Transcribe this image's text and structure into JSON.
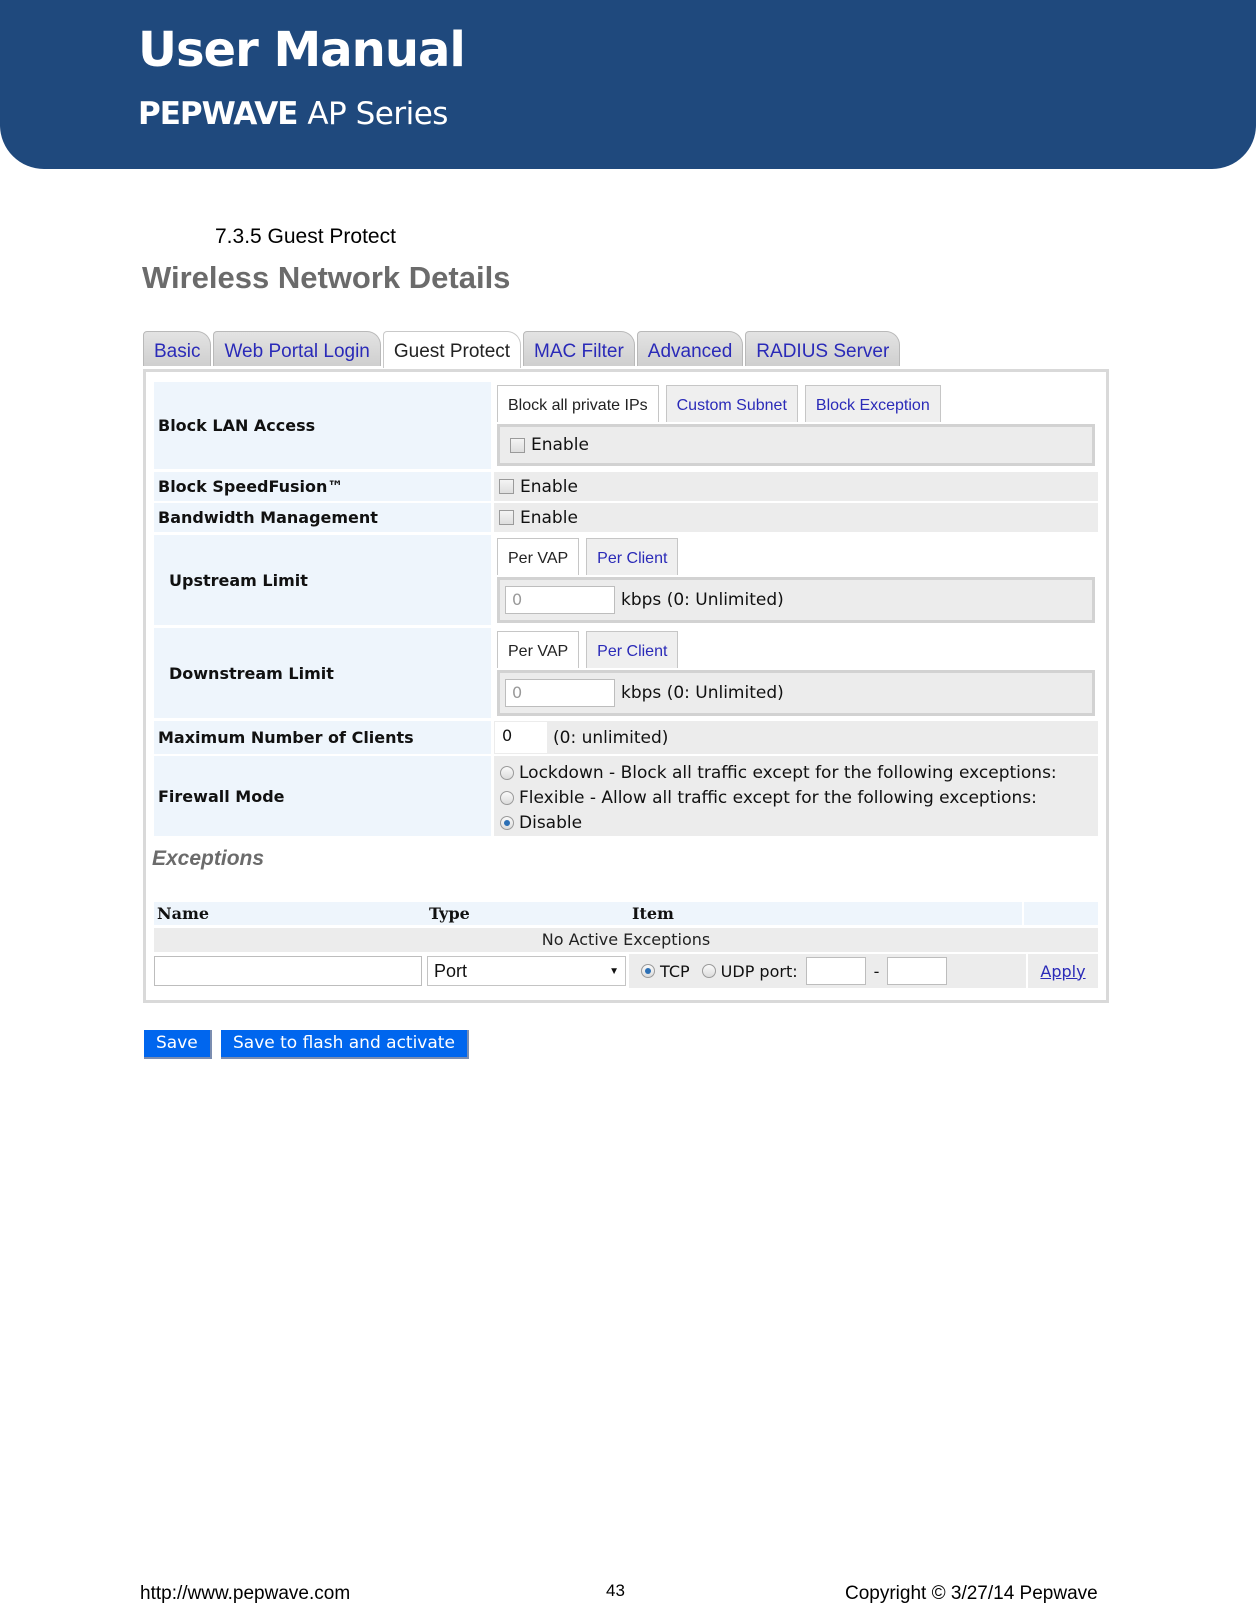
{
  "header": {
    "title": "User Manual",
    "brand": "PEPWAVE",
    "series": "AP Series",
    "color": "#1f497d"
  },
  "section_heading": "7.3.5 Guest Protect",
  "page_title": "Wireless Network Details",
  "tabs": [
    {
      "label": "Basic",
      "active": false
    },
    {
      "label": "Web Portal Login",
      "active": false
    },
    {
      "label": "Guest Protect",
      "active": true
    },
    {
      "label": "MAC Filter",
      "active": false
    },
    {
      "label": "Advanced",
      "active": false
    },
    {
      "label": "RADIUS Server",
      "active": false
    }
  ],
  "form": {
    "block_lan": {
      "label": "Block LAN Access",
      "subtabs": [
        "Block all private IPs",
        "Custom Subnet",
        "Block Exception"
      ],
      "active_subtab": "Block all private IPs",
      "enable_label": "Enable",
      "enabled": false
    },
    "block_speedfusion": {
      "label": "Block SpeedFusion™",
      "enable_label": "Enable",
      "enabled": false
    },
    "bandwidth_management": {
      "label": "Bandwidth Management",
      "enable_label": "Enable",
      "enabled": false
    },
    "upstream": {
      "label": "Upstream Limit",
      "subtabs": [
        "Per VAP",
        "Per Client"
      ],
      "active_subtab": "Per VAP",
      "value": "0",
      "unit": "kbps (0: Unlimited)"
    },
    "downstream": {
      "label": "Downstream Limit",
      "subtabs": [
        "Per VAP",
        "Per Client"
      ],
      "active_subtab": "Per VAP",
      "value": "0",
      "unit": "kbps (0: Unlimited)"
    },
    "max_clients": {
      "label": "Maximum Number of Clients",
      "value": "0",
      "hint": "(0: unlimited)"
    },
    "firewall_mode": {
      "label": "Firewall Mode",
      "options": [
        {
          "label": "Lockdown - Block all traffic except for the following exceptions:",
          "selected": false
        },
        {
          "label": "Flexible - Allow all traffic except for the following exceptions:",
          "selected": false
        },
        {
          "label": "Disable",
          "selected": true
        }
      ]
    }
  },
  "exceptions": {
    "title": "Exceptions",
    "columns": [
      "Name",
      "Type",
      "Item"
    ],
    "empty_text": "No Active Exceptions",
    "new_row": {
      "name_value": "",
      "type_value": "Port",
      "protocols": [
        {
          "label": "TCP",
          "selected": true
        },
        {
          "label": "UDP port:",
          "selected": false
        }
      ],
      "port_from": "",
      "port_separator": "-",
      "port_to": "",
      "apply_label": "Apply"
    }
  },
  "buttons": {
    "save": "Save",
    "save_activate": "Save to flash and activate"
  },
  "footer": {
    "url": "http://www.pepwave.com",
    "page": "43",
    "copyright": "Copyright © 3/27/14 Pepwave"
  }
}
